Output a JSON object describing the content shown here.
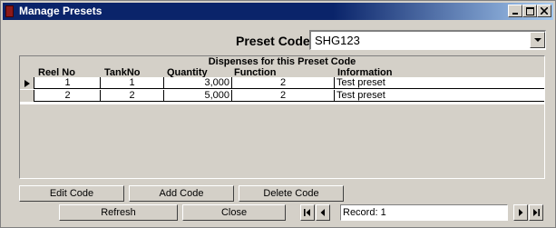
{
  "window": {
    "title": "Manage Presets",
    "controls": [
      "minimize-icon",
      "maximize-icon",
      "close-icon"
    ]
  },
  "preset": {
    "label": "Preset Code",
    "value": "SHG123"
  },
  "dispenses": {
    "title": "Dispenses for this Preset Code",
    "columns": [
      "Reel No",
      "TankNo",
      "Quantity",
      "Function",
      "Information"
    ],
    "rows": [
      {
        "reel_no": "1",
        "tank_no": "1",
        "quantity": "3,000",
        "function": "2",
        "information": "Test preset"
      },
      {
        "reel_no": "2",
        "tank_no": "2",
        "quantity": "5,000",
        "function": "2",
        "information": "Test preset"
      }
    ],
    "current_row_indicator": "arrow-right-icon"
  },
  "buttons": {
    "edit_code": "Edit Code",
    "add_code": "Add Code",
    "delete_code": "Delete Code",
    "refresh": "Refresh",
    "close": "Close"
  },
  "navigator": {
    "record_label": "Record: 1",
    "icons": [
      "first-record-icon",
      "previous-record-icon",
      "next-record-icon",
      "last-record-icon"
    ]
  },
  "colors": {
    "title_bar": "#0a246a",
    "face": "#d4d0c8"
  }
}
